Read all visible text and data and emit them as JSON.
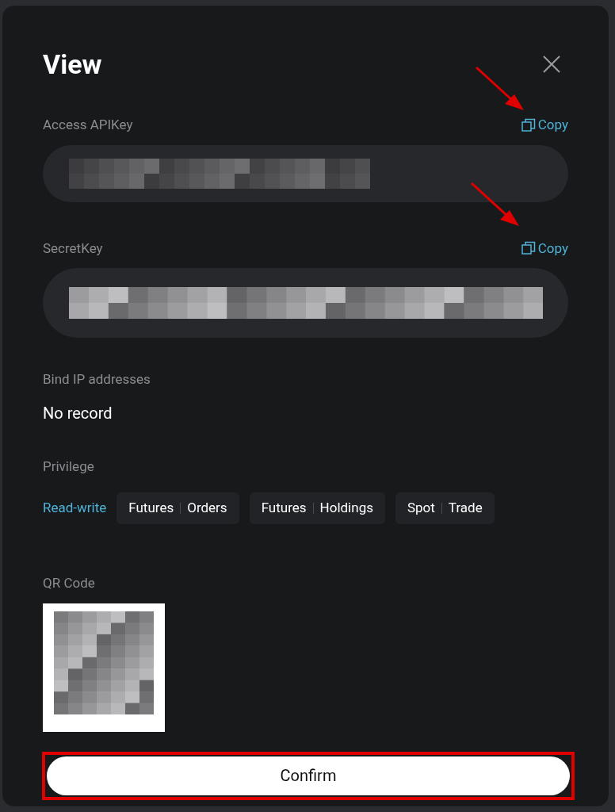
{
  "dialog": {
    "title": "View"
  },
  "fields": [
    {
      "label": "Access APIKey",
      "copy_label": "Copy",
      "kind": "one-line"
    },
    {
      "label": "SecretKey",
      "copy_label": "Copy",
      "kind": "two-line"
    }
  ],
  "bind_ip": {
    "label": "Bind IP addresses",
    "value": "No record"
  },
  "privilege": {
    "label": "Privilege",
    "access": "Read-write",
    "permissions": [
      {
        "group": "Futures",
        "action": "Orders"
      },
      {
        "group": "Futures",
        "action": "Holdings"
      },
      {
        "group": "Spot",
        "action": "Trade"
      }
    ]
  },
  "qr_code": {
    "label": "QR Code"
  },
  "confirm_button": "Confirm"
}
